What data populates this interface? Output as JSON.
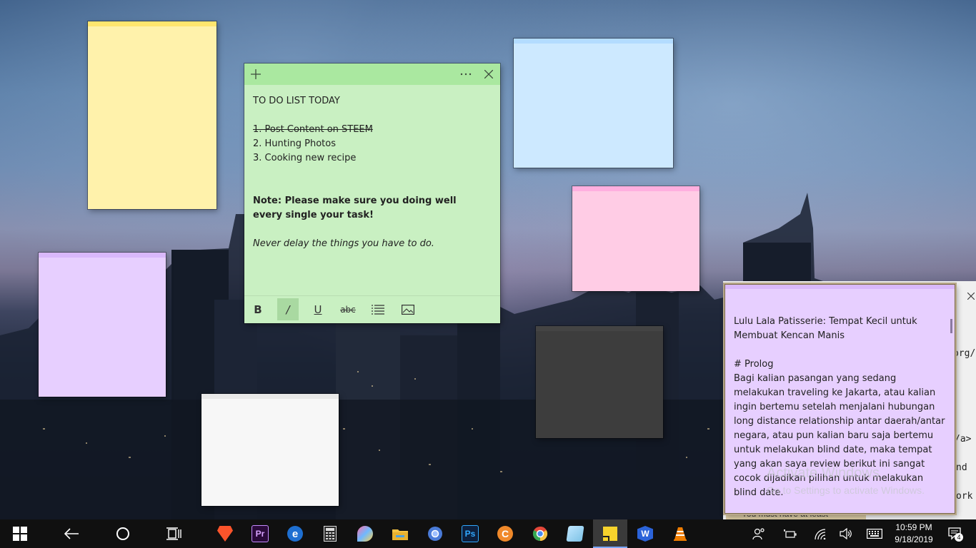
{
  "desktop": {
    "watermark": {
      "title": "Activate Windows",
      "subtitle": "Go to Settings to activate Windows."
    },
    "background_window_fragments": [
      "org/",
      "/a>",
      "nd",
      "ork",
      "You must have at least"
    ]
  },
  "notes": {
    "green": {
      "color": "#c9f0c2",
      "lines": [
        "TO DO LIST TODAY",
        "",
        "1. Post Content on STEEM",
        "2. Hunting Photos",
        "3. Cooking new recipe",
        "",
        "",
        "Note: Please make sure you doing well every single your task!",
        "",
        "Never delay the things you have to do."
      ],
      "toolbar": {
        "bold": "B",
        "italic": "/",
        "underline": "U",
        "strikethrough": "abc"
      }
    },
    "purple_large": {
      "color": "#e7cfff",
      "title": "Lulu Lala Patisserie: Tempat Kecil untuk Membuat Kencan Manis",
      "heading": "# Prolog",
      "paragraph": "Bagi kalian pasangan yang sedang melakukan traveling ke Jakarta, atau kalian ingin bertemu setelah menjalani hubungan long distance relationship antar daerah/antar negara, atau pun kalian baru saja bertemu untuk melakukan blind date, maka tempat yang akan saya review berikut ini sangat cocok dijadikan pilihan untuk melakukan blind date."
    },
    "colors": {
      "yellow": "#fff2ab",
      "blue": "#cde9ff",
      "pink": "#ffcce5",
      "purple": "#e7cfff",
      "white": "#f7f7f7",
      "charcoal": "#3d3d3d"
    }
  },
  "taskbar": {
    "pinned": [
      {
        "name": "brave",
        "label": "",
        "color": "#fb542b"
      },
      {
        "name": "premiere-pro",
        "label": "Pr",
        "color": "#2a0a3a"
      },
      {
        "name": "edge",
        "label": "e",
        "color": "#1e6fd1"
      },
      {
        "name": "calculator",
        "label": "",
        "color": "#3a3a3a"
      },
      {
        "name": "paint-3d",
        "label": "",
        "color": "#ff6fa8"
      },
      {
        "name": "file-explorer",
        "label": "",
        "color": "#f6c343"
      },
      {
        "name": "chromium",
        "label": "",
        "color": "#4a7bd8"
      },
      {
        "name": "photoshop",
        "label": "Ps",
        "color": "#0c1f3d"
      },
      {
        "name": "coccoc",
        "label": "C",
        "color": "#f0892a"
      },
      {
        "name": "chrome",
        "label": "",
        "color": "#e5483a"
      },
      {
        "name": "notepad",
        "label": "",
        "color": "#7ec3e6"
      },
      {
        "name": "sticky-notes",
        "label": "",
        "color": "#f7d32c"
      },
      {
        "name": "wps-writer",
        "label": "W",
        "color": "#2b63d9"
      },
      {
        "name": "vlc",
        "label": "",
        "color": "#ef7d00"
      }
    ],
    "clock": {
      "time": "10:59 PM",
      "date": "9/18/2019"
    },
    "notification_count": "4"
  }
}
